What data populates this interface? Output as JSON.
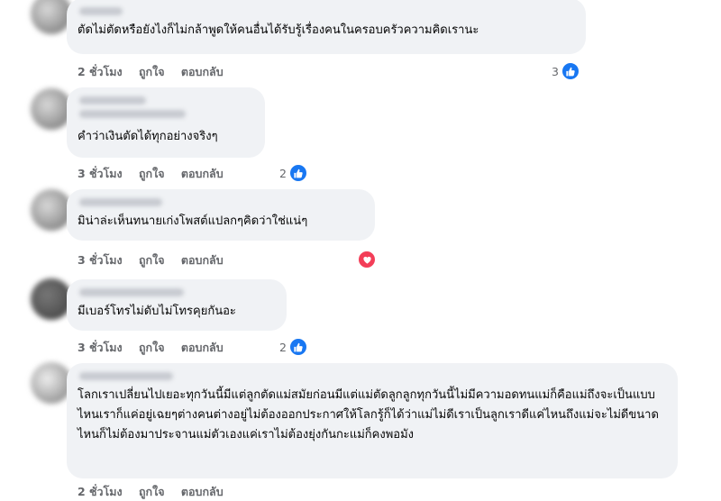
{
  "comments": [
    {
      "text": "ตัดไม่ตัดหรือยังไงก็ไม่กล้าพูดให้คนอื่นได้รับรู้เรื่องคนในครอบครัวความคิดเรานะ",
      "time": "2 ชั่วโมง",
      "like": "ถูกใจ",
      "reply": "ตอบกลับ",
      "reaction": {
        "count": "3",
        "type": "like-icon"
      }
    },
    {
      "text": "คำว่าเงินตัดได้ทุกอย่างจริงๆ",
      "time": "3 ชั่วโมง",
      "like": "ถูกใจ",
      "reply": "ตอบกลับ",
      "reaction": {
        "count": "2",
        "type": "like-icon"
      }
    },
    {
      "text": "มิน่าล่ะเห็นทนายเก่งโพสต์แปลกๆคิดว่าใช่แน่ๆ",
      "time": "3 ชั่วโมง",
      "like": "ถูกใจ",
      "reply": "ตอบกลับ",
      "reaction": {
        "count": "",
        "type": "heart-icon"
      }
    },
    {
      "text": "มีเบอร์โทรไม่ดับไม่โทรคุยกันอะ",
      "time": "3 ชั่วโมง",
      "like": "ถูกใจ",
      "reply": "ตอบกลับ",
      "reaction": {
        "count": "2",
        "type": "like-icon"
      }
    },
    {
      "text": "โลกเราเปลี่ยนไปเยอะทุกวันนี้มีแต่ลูกตัดแม่สมัยก่อนมีแต่แม่ตัดลูกลูกทุกวันนี้ไม่มีความอดทนแม่ก็คือแม่ถึงจะเป็นแบบไหนเราก็แค่อยู่เฉยๆต่างคนต่างอยู่ไม่ต้องออกประกาศให้โลกรู้ก็ได้ว่าแม่ไม่ดีเราเป็นลูกเราดีแค่ไหนถึงแม่จะไม่ดีขนาดไหนก็ไม่ต้องมาประจานแม่ตัวเองแค่เราไม่ต้องยุ่งกันกะแม่ก็คงพอมัง",
      "time": "2 ชั่วโมง",
      "like": "ถูกใจ",
      "reply": "ตอบกลับ",
      "reaction": {
        "count": "",
        "type": ""
      }
    }
  ]
}
